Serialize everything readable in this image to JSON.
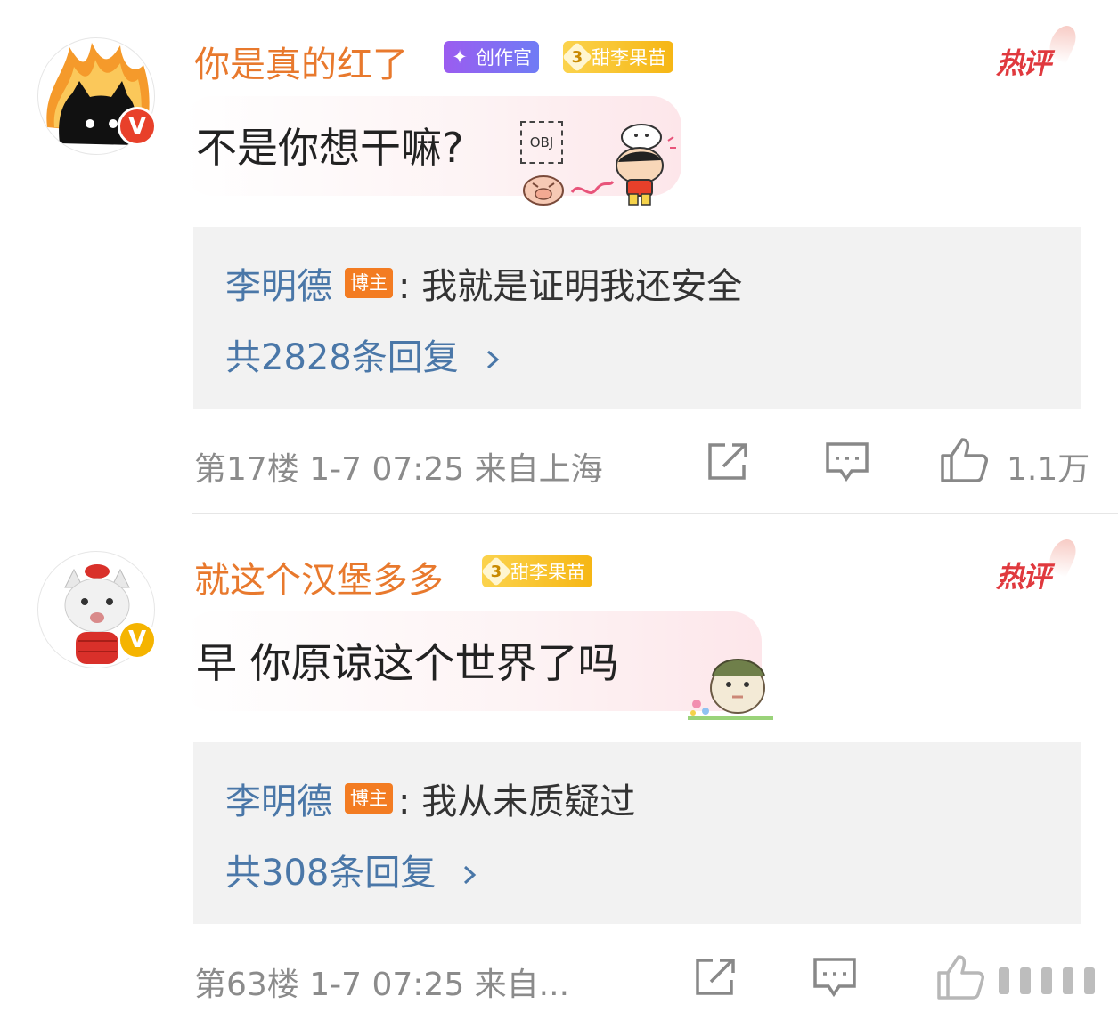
{
  "comments": [
    {
      "username": "你是真的红了",
      "badges": {
        "creator": "创作官",
        "level": "3",
        "fan": "甜李果苗"
      },
      "hot_label": "热评",
      "text": "不是你想干嘛?",
      "obj_label": "OBJ",
      "reply": {
        "author": "李明德",
        "author_badge": "博主",
        "text": ": 我就是证明我还安全",
        "count": "共2828条回复"
      },
      "meta": "第17楼 1-7 07:25  来自上海",
      "likes": "1.1万",
      "avatar_icon": "black-cat-fire-avatar",
      "verified_color": "#e8402a"
    },
    {
      "username": "就这个汉堡多多",
      "badges": {
        "level": "3",
        "fan": "甜李果苗"
      },
      "hot_label": "热评",
      "text": "早 你原谅这个世界了吗",
      "reply": {
        "author": "李明德",
        "author_badge": "博主",
        "text": ": 我从未质疑过",
        "count": "共308条回复"
      },
      "meta": "第63楼 1-7 07:25  来自...",
      "avatar_icon": "white-cat-red-jacket-avatar",
      "verified_color": "#f5b400"
    }
  ],
  "icons": {
    "share": "share-icon",
    "comment": "comment-icon",
    "like": "like-icon",
    "chevron": "chevron-right-icon"
  },
  "colors": {
    "username": "#e8792d",
    "reply_link": "#4a77a8",
    "hot": "#e0393e",
    "meta": "#8b8b8b"
  }
}
